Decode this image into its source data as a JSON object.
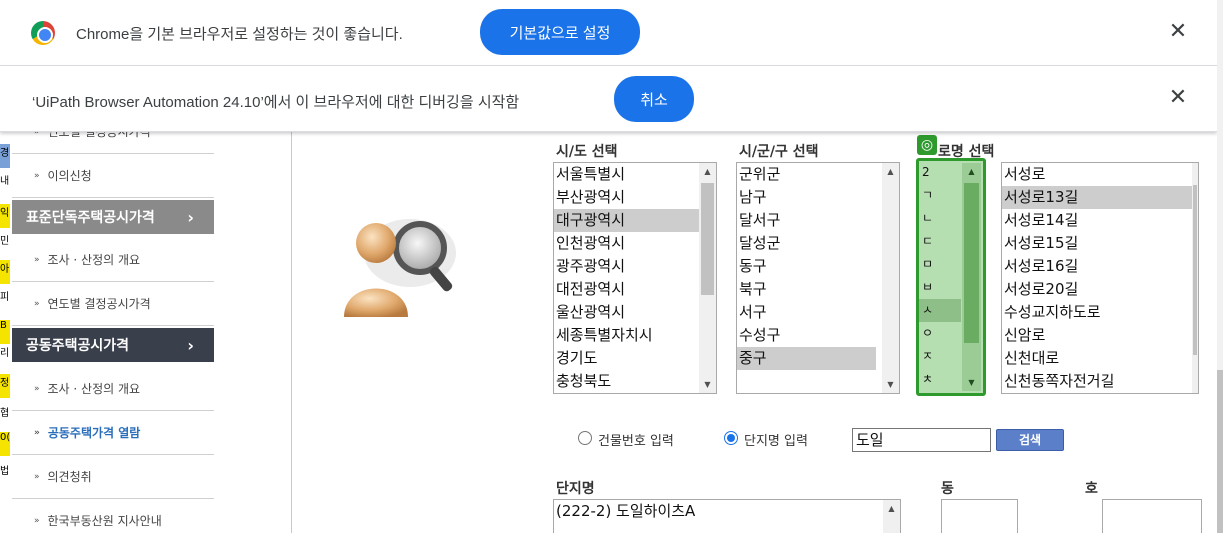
{
  "infobar_default": {
    "message": "Chrome을 기본 브라우저로 설정하는 것이 좋습니다.",
    "button": "기본값으로 설정",
    "close": "✕"
  },
  "infobar_debug": {
    "message": "‘UiPath Browser Automation 24.10’에서 이 브라우저에 대한 디버깅을 시작함",
    "button": "취소",
    "close": "✕"
  },
  "left_strip": [
    "경",
    "내",
    "익",
    "민",
    "아",
    "피",
    "B",
    "리",
    "정",
    "협",
    "0(",
    "법"
  ],
  "sidenav": {
    "items": [
      {
        "label": "연도별 결정공시가격",
        "type": "sub"
      },
      {
        "label": "이의신청",
        "type": "sub"
      },
      {
        "label": "표준단독주택공시가격",
        "type": "head-grey"
      },
      {
        "label": "조사 · 산정의 개요",
        "type": "sub"
      },
      {
        "label": "연도별 결정공시가격",
        "type": "sub"
      },
      {
        "label": "공동주택공시가격",
        "type": "head-dark"
      },
      {
        "label": "조사 · 산정의 개요",
        "type": "sub"
      },
      {
        "label": "공동주택가격 열람",
        "type": "sub-active"
      },
      {
        "label": "의견청취",
        "type": "sub"
      },
      {
        "label": "한국부동산원 지사안내",
        "type": "sub"
      }
    ],
    "arrow": "›",
    "bullet": "»"
  },
  "sido": {
    "label": "시/도 선택",
    "options": [
      "서울특별시",
      "부산광역시",
      "대구광역시",
      "인천광역시",
      "광주광역시",
      "대전광역시",
      "울산광역시",
      "세종특별자치시",
      "경기도",
      "충청북도"
    ],
    "selected": "대구광역시"
  },
  "sigungu": {
    "label": "시/군/구 선택",
    "options": [
      "군위군",
      "남구",
      "달서구",
      "달성군",
      "동구",
      "북구",
      "서구",
      "수성구",
      "중구"
    ],
    "selected": "중구"
  },
  "road": {
    "label": "로명 선택",
    "label_prefix_icon": "◎",
    "initials": [
      "2",
      "ㄱ",
      "ㄴ",
      "ㄷ",
      "ㅁ",
      "ㅂ",
      "ㅅ",
      "ㅇ",
      "ㅈ",
      "ㅊ"
    ],
    "initial_selected": "ㅅ",
    "options": [
      "서성로",
      "서성로13길",
      "서성로14길",
      "서성로15길",
      "서성로16길",
      "서성로20길",
      "수성교지하도로",
      "신암로",
      "신천대로",
      "신천동쪽자전거길"
    ],
    "selected": "서성로13길"
  },
  "search": {
    "radio_building": "건물번호 입력",
    "radio_complex": "단지명 입력",
    "radio_selected": "단지명 입력",
    "input_value": "도일",
    "button": "검색"
  },
  "results": {
    "complex_label": "단지명",
    "complex_items": [
      "(222-2) 도일하이츠A"
    ],
    "dong_label": "동",
    "ho_label": "호"
  },
  "icons": {
    "chrome": "chrome-logo-icon",
    "close": "close-icon",
    "target": "target-icon",
    "scroll_up": "▲",
    "scroll_down": "▼"
  }
}
